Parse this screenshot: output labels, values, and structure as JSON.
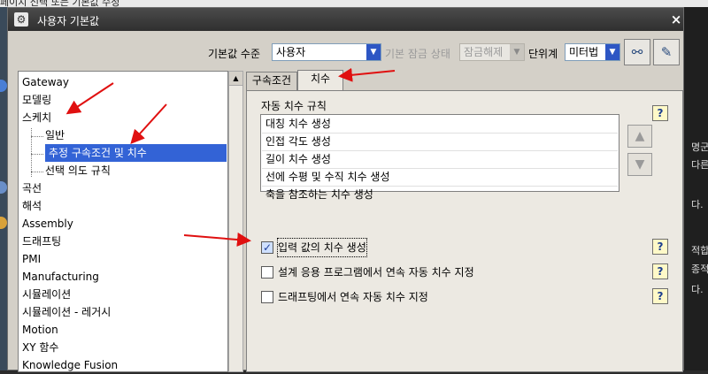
{
  "background": {
    "top_text": "페이지 선택 또는 기본값 수정",
    "right_texts": [
      "명군",
      "다른",
      "다.",
      "적합",
      "종적",
      "다."
    ]
  },
  "window": {
    "title": "사용자 기본값",
    "close_label": "×"
  },
  "toolbar": {
    "level_label": "기본값 수준",
    "level_value": "사용자",
    "lock_status_label": "기본 잠금 상태",
    "lock_status_value": "잠금해제",
    "unit_label": "단위계",
    "unit_value": "미터법"
  },
  "tree": {
    "items": [
      {
        "label": "Gateway"
      },
      {
        "label": "모델링"
      },
      {
        "label": "스케치"
      },
      {
        "label": "일반"
      },
      {
        "label": "추정 구속조건 및 치수"
      },
      {
        "label": "선택 의도 규칙"
      },
      {
        "label": "곡선"
      },
      {
        "label": "해석"
      },
      {
        "label": "Assembly"
      },
      {
        "label": "드래프팅"
      },
      {
        "label": "PMI"
      },
      {
        "label": "Manufacturing"
      },
      {
        "label": "시뮬레이션"
      },
      {
        "label": "시뮬레이션 - 레거시"
      },
      {
        "label": "Motion"
      },
      {
        "label": "XY 함수"
      },
      {
        "label": "Knowledge Fusion"
      }
    ]
  },
  "tabs": [
    {
      "label": "구속조건"
    },
    {
      "label": "치수"
    }
  ],
  "auto_dimension": {
    "group_title": "자동 치수 규칙",
    "rules": [
      "대칭 치수 생성",
      "인접 각도 생성",
      "길이 치수 생성",
      "선에 수평 및 수직 치수 생성",
      "축을 참조하는 치수 생성"
    ]
  },
  "options": [
    {
      "label": "입력 값의 치수 생성",
      "checked": true
    },
    {
      "label": "설계 응용 프로그램에서 연속 자동 치수 지정",
      "checked": false
    },
    {
      "label": "드래프팅에서 연속 자동 치수 지정",
      "checked": false
    }
  ],
  "help_label": "?",
  "colors": {
    "selection": "#3363d6",
    "annotation_arrow": "#e01010",
    "titlebar": "#3a3a3a",
    "dialog_face": "#d4d0c8"
  }
}
